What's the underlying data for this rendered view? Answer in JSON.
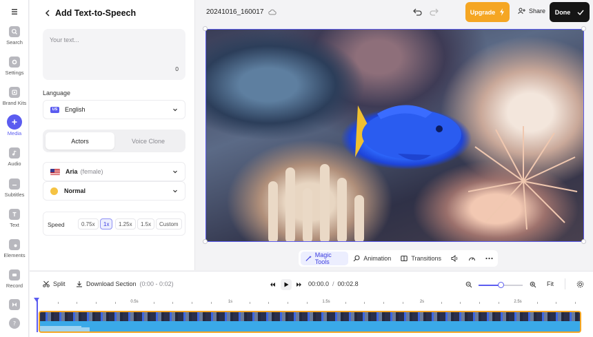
{
  "rail": {
    "items": [
      {
        "label": "Search",
        "icon": "search-icon"
      },
      {
        "label": "Settings",
        "icon": "gear-icon"
      },
      {
        "label": "Brand Kits",
        "icon": "brand-kit-icon"
      },
      {
        "label": "Media",
        "icon": "plus-icon",
        "active": true
      },
      {
        "label": "Audio",
        "icon": "music-icon"
      },
      {
        "label": "Subtitles",
        "icon": "subtitles-icon"
      },
      {
        "label": "Text",
        "icon": "text-icon"
      },
      {
        "label": "Elements",
        "icon": "elements-icon"
      },
      {
        "label": "Record",
        "icon": "record-icon"
      }
    ]
  },
  "panel": {
    "title": "Add Text-to-Speech",
    "text_placeholder": "Your text...",
    "char_count": "0",
    "language_label": "Language",
    "language_flag": "US",
    "language_value": "English",
    "tabs": [
      "Actors",
      "Voice Clone"
    ],
    "actor_name": "Aria",
    "actor_note": "(female)",
    "tone": "Normal",
    "speed_label": "Speed",
    "speeds": [
      "0.75x",
      "1x",
      "1.25x",
      "1.5x",
      "Custom"
    ],
    "selected_speed": "1x"
  },
  "topbar": {
    "project_name": "20241016_160017",
    "upgrade_label": "Upgrade",
    "share_label": "Share",
    "done_label": "Done"
  },
  "canvas_tools": {
    "magic_tools": "Magic Tools",
    "animation": "Animation",
    "transitions": "Transitions"
  },
  "timeline": {
    "split_label": "Split",
    "download_label": "Download Section",
    "download_range": "(0:00 - 0:02)",
    "current_time": "00:00.0",
    "separator": "/",
    "total_time": "00:02.8",
    "fit_label": "Fit",
    "zoom_level": 0.5,
    "ruler_labels": [
      "0.5s",
      "1s",
      "1.5s",
      "2s",
      "2.5s"
    ]
  },
  "colors": {
    "accent": "#5b5cf0",
    "upgrade": "#f5a623",
    "done": "#151515",
    "clip_border": "#f5a623",
    "audio_track": "#3aa9e8"
  }
}
